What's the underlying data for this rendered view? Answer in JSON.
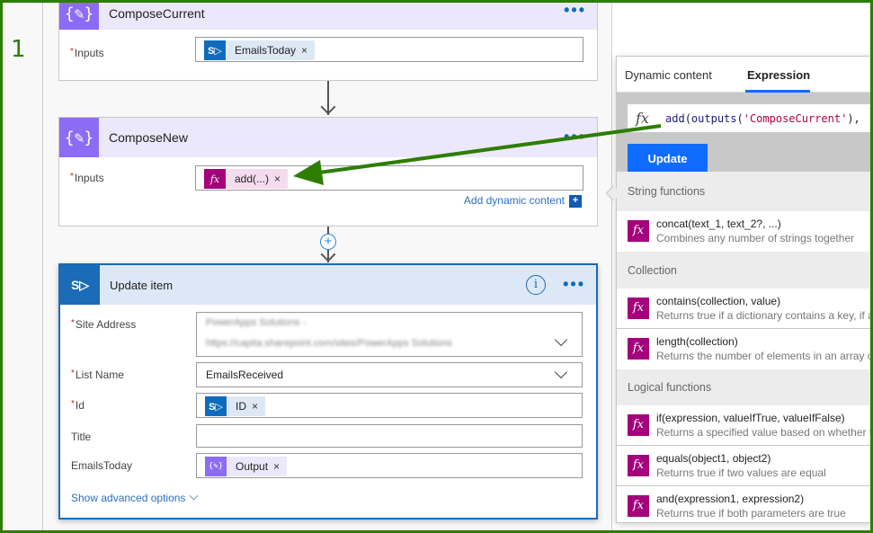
{
  "step_number": "1",
  "cards": {
    "compose_current": {
      "title": "ComposeCurrent",
      "more_label": "•••",
      "icon": "compose-icon",
      "inputs_label": "Inputs",
      "required_mark": "*",
      "token": {
        "label": "EmailsToday",
        "icon": "sharepoint-icon",
        "remove": "×"
      }
    },
    "compose_new": {
      "title": "ComposeNew",
      "more_label": "•••",
      "icon": "compose-icon",
      "inputs_label": "Inputs",
      "required_mark": "*",
      "token": {
        "label": "add(...)",
        "icon": "fx-icon",
        "remove": "×"
      },
      "add_dynamic_content": "Add dynamic content",
      "add_dynamic_icon": "+"
    },
    "update_item": {
      "title": "Update item",
      "icon": "sharepoint-icon",
      "info_label": "i",
      "more_label": "•••",
      "required_mark": "*",
      "fields": {
        "site_address": {
          "label": "Site Address",
          "line1": "PowerApps Solutions -",
          "line2": "https://capita.sharepoint.com/sites/PowerApps Solutions"
        },
        "list_name": {
          "label": "List Name",
          "value": "EmailsReceived"
        },
        "id": {
          "label": "Id",
          "token": "ID",
          "remove": "×"
        },
        "title": {
          "label": "Title",
          "value": ""
        },
        "emails_today": {
          "label": "EmailsToday",
          "token": "Output",
          "remove": "×"
        }
      },
      "show_advanced": "Show advanced options"
    }
  },
  "panel": {
    "tabs": [
      {
        "label": "Dynamic content",
        "active": false
      },
      {
        "label": "Expression",
        "active": true
      }
    ],
    "expression": {
      "fx_label": "fx",
      "fn": "add",
      "open": "(",
      "inner_fn": "outputs",
      "inner_open": "(",
      "string_arg": "'ComposeCurrent'",
      "inner_close": "),"
    },
    "update_button": "Update",
    "sections": [
      {
        "header": "String functions",
        "items": [
          {
            "name": "concat(text_1, text_2?, ...)",
            "desc": "Combines any number of strings together"
          }
        ]
      },
      {
        "header": "Collection",
        "items": [
          {
            "name": "contains(collection, value)",
            "desc": "Returns true if a dictionary contains a key, if a"
          },
          {
            "name": "length(collection)",
            "desc": "Returns the number of elements in an array o"
          }
        ]
      },
      {
        "header": "Logical functions",
        "items": [
          {
            "name": "if(expression, valueIfTrue, valueIfFalse)",
            "desc": "Returns a specified value based on whether th"
          },
          {
            "name": "equals(object1, object2)",
            "desc": "Returns true if two values are equal"
          },
          {
            "name": "and(expression1, expression2)",
            "desc": "Returns true if both parameters are true"
          }
        ]
      }
    ],
    "fx_icon_label": "fx"
  },
  "colors": {
    "annotation_green": "#2d7d00",
    "compose_purple": "#8c6cf4",
    "sharepoint_blue": "#1a6bb8",
    "fx_magenta": "#a4007c",
    "update_blue": "#0f6cff"
  }
}
